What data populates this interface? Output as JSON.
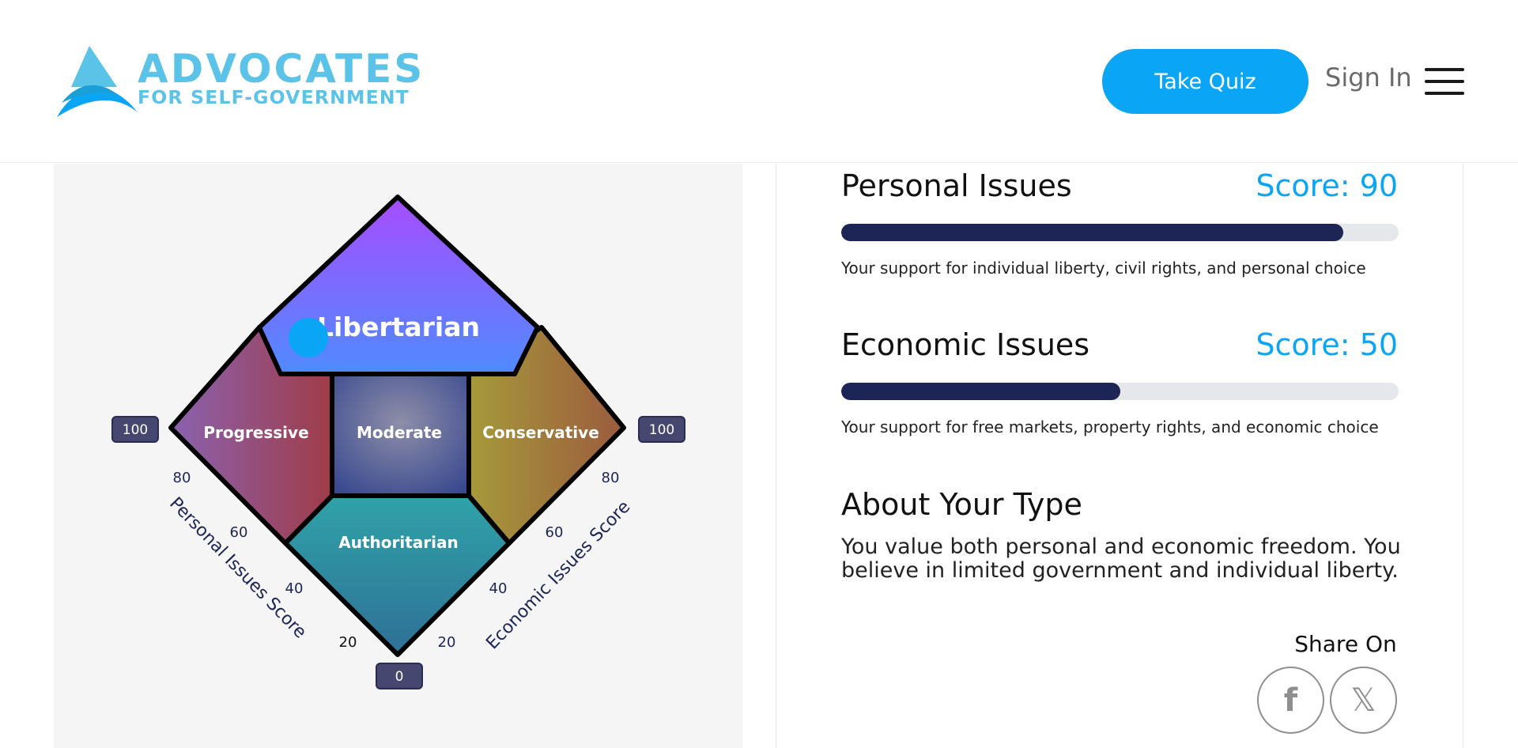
{
  "brand": {
    "title": "ADVOCATES",
    "subtitle": "FOR SELF-GOVERNMENT",
    "color": "#5bc2e8"
  },
  "header": {
    "take_quiz_label": "Take Quiz",
    "sign_in_label": "Sign In",
    "menu_icon": "hamburger-icon",
    "accent": "#0aa6f5"
  },
  "chart": {
    "regions": {
      "libertarian": "Libertarian",
      "progressive": "Progressive",
      "moderate": "Moderate",
      "conservative": "Conservative",
      "authoritarian": "Authoritarian"
    },
    "left_axis_label": "Personal Issues Score",
    "right_axis_label": "Economic Issues Score",
    "left_top_badge": "100",
    "right_top_badge": "100",
    "bottom_badge": "0",
    "left_ticks": [
      "80",
      "60",
      "40",
      "20"
    ],
    "right_ticks": [
      "80",
      "60",
      "40",
      "20"
    ],
    "result_marker": {
      "personal": 90,
      "economic": 50,
      "color": "#0aa6f5"
    }
  },
  "results": {
    "personal": {
      "title": "Personal Issues",
      "score_label": "Score: 90",
      "score": 90,
      "description": "Your support for individual liberty, civil rights, and personal choice"
    },
    "economic": {
      "title": "Economic Issues",
      "score_label": "Score: 50",
      "score": 50,
      "description": "Your support for free markets, property rights, and economic choice"
    },
    "about": {
      "title": "About Your Type",
      "text": "You value both personal and economic freedom. You believe in limited government and individual liberty."
    },
    "share": {
      "label": "Share On",
      "facebook_icon": "facebook-icon",
      "facebook_glyph": "f",
      "x_icon": "x-icon",
      "x_glyph": "𝕏"
    }
  }
}
